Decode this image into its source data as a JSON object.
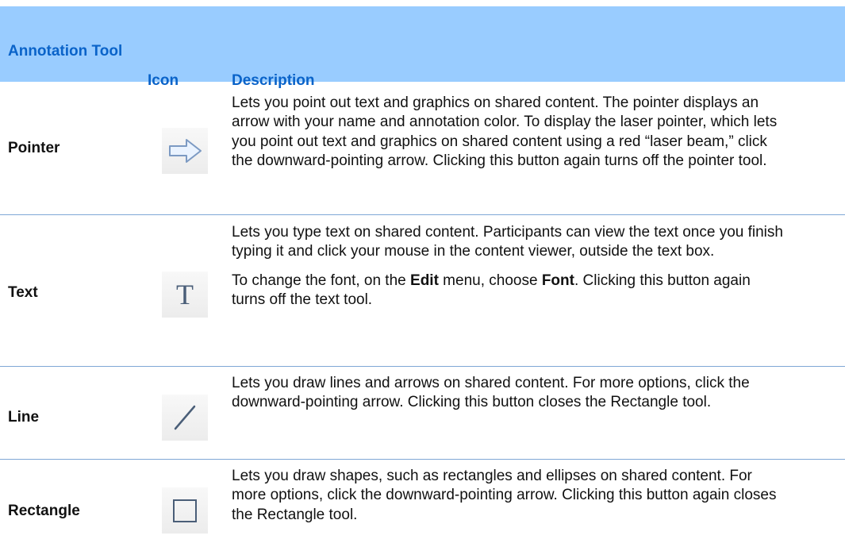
{
  "table": {
    "headers": {
      "tool": "Annotation Tool",
      "icon": "Icon",
      "description": "Description"
    },
    "rows": [
      {
        "name": "Pointer",
        "icon": "arrow-right-icon",
        "description": [
          "Lets you point out text and graphics on shared content. The pointer displays an arrow with your name and annotation color. To display the laser pointer, which lets you point out text and graphics on shared content using a red “laser beam,” click the downward-pointing arrow. Clicking this button again turns off the pointer tool."
        ]
      },
      {
        "name": "Text",
        "icon": "text-tool-icon",
        "icon_glyph": "T",
        "description": [
          "Lets you type text on shared content. Participants can view the text once you finish typing it and click your mouse in the content viewer, outside the text box."
        ],
        "description_rich": {
          "part1": "To change the font, on the ",
          "bold1": "Edit",
          "part2": " menu, choose ",
          "bold2": "Font",
          "part3": ". Clicking this button again turns off the text tool."
        }
      },
      {
        "name": "Line",
        "icon": "line-tool-icon",
        "description": [
          "Lets you draw lines and arrows on shared content. For more options, click the downward-pointing arrow. Clicking this button closes the Rectangle tool."
        ]
      },
      {
        "name": "Rectangle",
        "icon": "rectangle-tool-icon",
        "description": [
          "Lets you draw shapes, such as rectangles and ellipses on shared content. For more options, click the downward-pointing arrow. Clicking this button again closes the Rectangle tool."
        ]
      }
    ]
  },
  "colors": {
    "header_bg": "#99ccff",
    "header_text": "#0a63c9",
    "separator": "#7fa7d6",
    "body_text": "#111111"
  }
}
